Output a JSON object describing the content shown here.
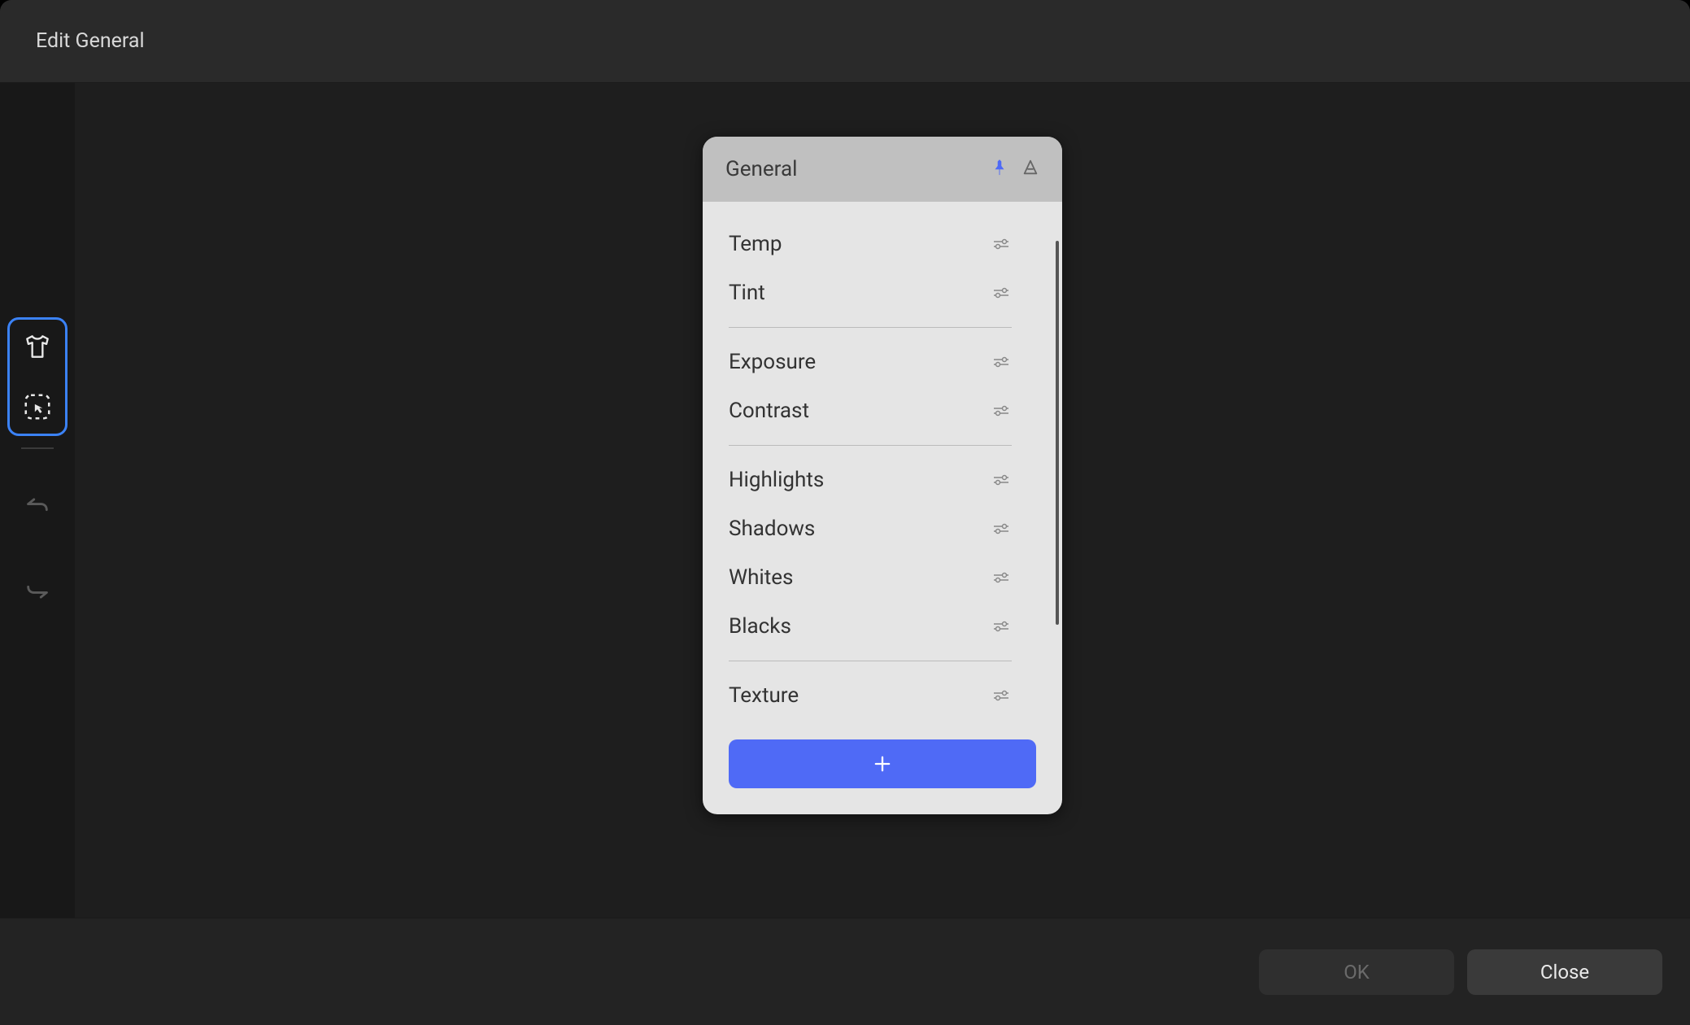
{
  "colors": {
    "accent": "#4f6af6",
    "selection": "#3b82f6"
  },
  "titlebar": {
    "title": "Edit General"
  },
  "sidebar": {
    "tools": [
      {
        "name": "shirt-tool"
      },
      {
        "name": "select-tool"
      }
    ],
    "actions": [
      {
        "name": "undo-action"
      },
      {
        "name": "redo-action"
      }
    ]
  },
  "panel": {
    "title": "General",
    "header_icons": [
      {
        "name": "pin-icon",
        "active": true
      },
      {
        "name": "reset-icon",
        "active": false
      }
    ],
    "groups": [
      {
        "params": [
          {
            "label": "Temp",
            "type": "slider"
          },
          {
            "label": "Tint",
            "type": "slider"
          }
        ]
      },
      {
        "params": [
          {
            "label": "Exposure",
            "type": "slider"
          },
          {
            "label": "Contrast",
            "type": "slider"
          }
        ]
      },
      {
        "params": [
          {
            "label": "Highlights",
            "type": "slider"
          },
          {
            "label": "Shadows",
            "type": "slider"
          },
          {
            "label": "Whites",
            "type": "slider"
          },
          {
            "label": "Blacks",
            "type": "slider"
          }
        ]
      },
      {
        "params": [
          {
            "label": "Texture",
            "type": "slider"
          }
        ]
      }
    ],
    "add_button": "+"
  },
  "footer": {
    "ok_label": "OK",
    "close_label": "Close"
  }
}
